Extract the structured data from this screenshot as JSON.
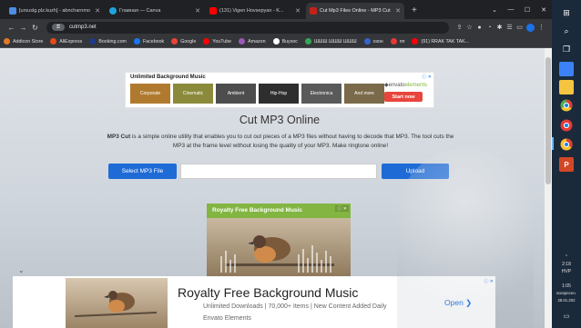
{
  "browser": {
    "tabs": [
      {
        "label": "[ursuslg.plz.kuzh] - abncharnmo",
        "icon_color": "#4e8de6",
        "active": false
      },
      {
        "label": "Главная — Canva",
        "icon_color": "#1fa3d9",
        "active": false
      },
      {
        "label": "(131) Vigen Hovsepyan - K...",
        "icon_color": "#ff0000",
        "active": false
      },
      {
        "label": "Cut Mp3 Files Online - MP3 Cut",
        "icon_color": "#c2221a",
        "active": true
      }
    ],
    "new_tab": "+",
    "window_controls": {
      "minimize": "—",
      "maximize": "☐",
      "close": "✕"
    },
    "url": "cutmp3.net",
    "lock_label": "⚿",
    "bookmarks": [
      {
        "label": "Addicon Store",
        "color": "#e07a2a"
      },
      {
        "label": "AliExpress",
        "color": "#e64a19"
      },
      {
        "label": "Booking.com",
        "color": "#1e3a8a"
      },
      {
        "label": "Facebook",
        "color": "#1877f2"
      },
      {
        "label": "Google",
        "color": "#ea4335"
      },
      {
        "label": "YouTube",
        "color": "#ff0000"
      },
      {
        "label": "Аmazon",
        "color": "#9b59b6"
      },
      {
        "label": "Buysoc",
        "color": "#ffffff"
      },
      {
        "label": "ШШШ ШШШ ШШШ",
        "color": "#34a853"
      },
      {
        "label": "озон",
        "color": "#3366cc"
      },
      {
        "label": "пп",
        "color": "#e53935"
      },
      {
        "label": "(91) RRAK TAK TAK...",
        "color": "#ff0000"
      }
    ]
  },
  "page": {
    "top_ad": {
      "title": "Unlimited Background Music",
      "categories": [
        {
          "label": "Corporate",
          "color": "#b07a2e"
        },
        {
          "label": "Cinematic",
          "color": "#8a8a3a"
        },
        {
          "label": "Ambient",
          "color": "#4d4d4d"
        },
        {
          "label": "Hip-Hop",
          "color": "#2e2e2e"
        },
        {
          "label": "Electronica",
          "color": "#5a5a5a"
        },
        {
          "label": "And more",
          "color": "#7a6a4a"
        }
      ],
      "brand_prefix": "◆envato",
      "brand_suffix": "elements",
      "cta": "Start now",
      "ad_marker": "ⓘ ✕"
    },
    "title": "Cut MP3 Online",
    "description_bold": "MP3 Cut",
    "description": " is a simple online utility that enables you to cut out pieces of a MP3 files without having to decode that MP3. The tool cuts the MP3 at the frame level without losing the quality of your MP3. Make ringtone online!",
    "select_button": "Select MP3 File",
    "file_field_value": "",
    "upload_button": "Upload",
    "mid_ad": {
      "headline": "Royalty Free Background Music",
      "ad_marker": "ⓘ ✕"
    },
    "collapse_toggle": "⌄",
    "bottom_ad": {
      "headline": "Royalty Free Background Music",
      "line1": "Unlimited Downloads | 70,000+ Items | New Content Added Daily",
      "line2": "Envato Elements",
      "cta": "Open ❯",
      "ad_marker": "ⓘ ✕"
    }
  },
  "taskbar": {
    "search_icon_glyph": "⌕",
    "apps": [
      {
        "name": "store",
        "color": "#3b82f6"
      },
      {
        "name": "files",
        "color": "#f5c542"
      },
      {
        "name": "chrome",
        "color": "#4caf50"
      },
      {
        "name": "chrome-alt",
        "color": "#e53935"
      },
      {
        "name": "chrome-active",
        "color": "#fbc02d"
      },
      {
        "name": "powerpoint",
        "color": "#d24726"
      }
    ],
    "time": "2:18",
    "lang": "HVP",
    "clock": "1:05",
    "day": "воскресен.",
    "date": "28.01.202"
  }
}
